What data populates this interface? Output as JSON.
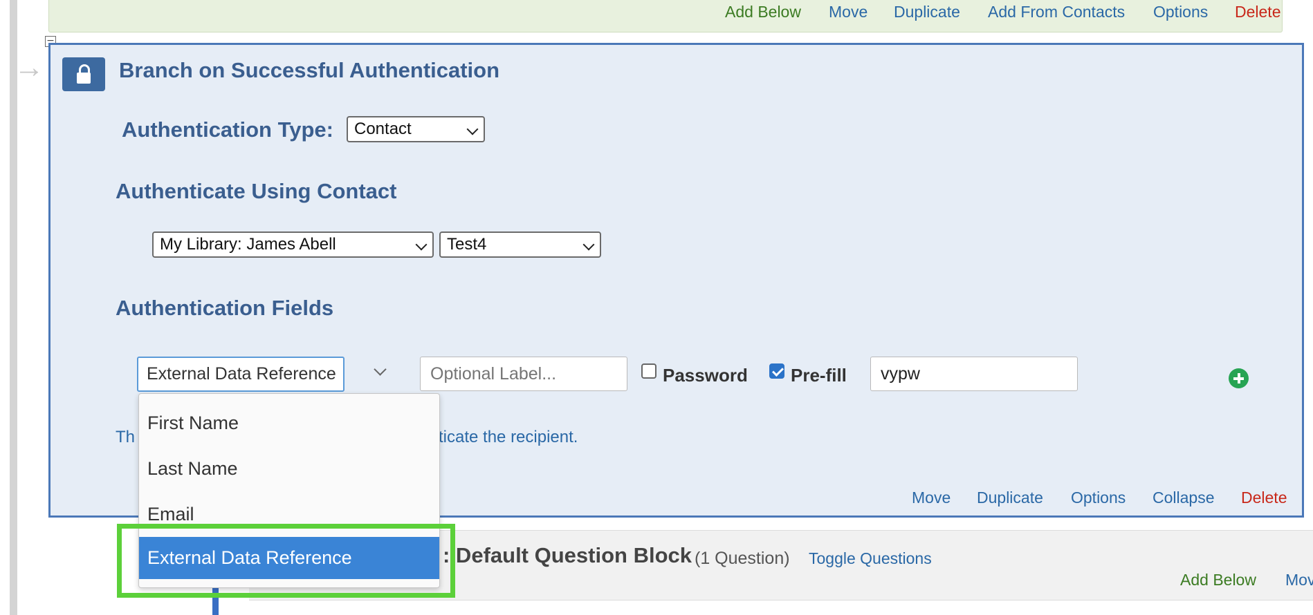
{
  "top_actions": {
    "add_below": "Add Below",
    "move": "Move",
    "duplicate": "Duplicate",
    "add_from_contacts": "Add From Contacts",
    "options": "Options",
    "delete": "Delete"
  },
  "panel": {
    "title": "Branch on Successful Authentication",
    "auth_type_label": "Authentication Type:",
    "auth_type_value": "Contact",
    "contact_heading": "Authenticate Using Contact",
    "library_value": "My Library: James Abell",
    "list_value": "Test4",
    "fields_heading": "Authentication Fields",
    "field_select_value": "External Data Reference",
    "label_placeholder": "Optional Label...",
    "password_label": "Password",
    "password_checked": false,
    "prefill_label": "Pre-fill",
    "prefill_checked": true,
    "prefill_value": "vypw",
    "info_prefix": "Th",
    "info_suffix": "ticate the recipient."
  },
  "panel_actions": {
    "move": "Move",
    "duplicate": "Duplicate",
    "options": "Options",
    "collapse": "Collapse",
    "delete": "Delete"
  },
  "dropdown": {
    "items": [
      "First Name",
      "Last Name",
      "Email",
      "External Data Reference"
    ],
    "selected_index": 3
  },
  "next_block": {
    "title_fragment": ": Default Question Block",
    "count": "(1 Question)",
    "toggle": "Toggle Questions",
    "add_below": "Add Below",
    "move_partial": "Mov"
  },
  "colors": {
    "panel_border": "#4b78b8",
    "link_blue": "#2a68a6",
    "delete_red": "#c8281a",
    "add_green": "#3b7b22",
    "highlight_green": "#5cd03a",
    "selected_blue": "#3a84d6"
  }
}
